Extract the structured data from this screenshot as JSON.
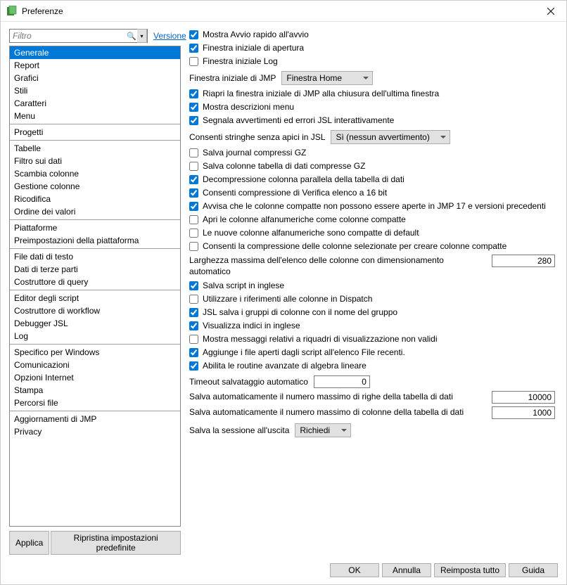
{
  "title": "Preferenze",
  "filter_placeholder": "Filtro",
  "version_link": "Versione",
  "categories": {
    "groups": [
      [
        "Generale",
        "Report",
        "Grafici",
        "Stili",
        "Caratteri",
        "Menu"
      ],
      [
        "Progetti"
      ],
      [
        "Tabelle",
        "Filtro sui dati",
        "Scambia colonne",
        "Gestione colonne",
        "Ricodifica",
        "Ordine dei valori"
      ],
      [
        "Piattaforme",
        "Preimpostazioni della piattaforma"
      ],
      [
        "File dati di testo",
        "Dati di terze parti",
        "Costruttore di query"
      ],
      [
        "Editor degli script",
        "Costruttore di workflow",
        "Debugger JSL",
        "Log"
      ],
      [
        "Specifico per Windows",
        "Comunicazioni",
        "Opzioni Internet",
        "Stampa",
        "Percorsi file"
      ],
      [
        "Aggiornamenti di JMP",
        "Privacy"
      ]
    ],
    "selected": "Generale"
  },
  "left_buttons": {
    "apply": "Applica",
    "restore": "Ripristina impostazioni predefinite"
  },
  "opts": {
    "c1": "Mostra Avvio rapido all'avvio",
    "c2": "Finestra iniziale di apertura",
    "c3": "Finestra iniziale Log",
    "lbl_initwin": "Finestra iniziale di JMP",
    "dd_initwin": "Finestra Home",
    "c4": "Riapri la finestra iniziale di JMP alla chiusura dell'ultima finestra",
    "c5": "Mostra descrizioni menu",
    "c6": "Segnala avvertimenti ed errori JSL interattivamente",
    "lbl_jslstr": "Consenti stringhe senza apici in JSL",
    "dd_jslstr": "Sì (nessun avvertimento)",
    "c7": "Salva journal compressi GZ",
    "c8": "Salva colonne tabella di dati compresse GZ",
    "c9": "Decompressione colonna parallela della tabella di dati",
    "c10": "Consenti compressione di Verifica elenco a 16 bit",
    "c11": "Avvisa che le colonne compatte non possono essere aperte in JMP 17 e versioni precedenti",
    "c12": "Apri le colonne alfanumeriche come colonne compatte",
    "c13": "Le nuove colonne alfanumeriche sono compatte di default",
    "c14": "Consenti la compressione delle colonne selezionate per creare colonne compatte",
    "lbl_maxwidth": "Larghezza massima dell'elenco delle colonne con dimensionamento automatico",
    "val_maxwidth": "280",
    "c15": "Salva script in inglese",
    "c16": "Utilizzare i riferimenti alle colonne in Dispatch",
    "c17": "JSL salva i gruppi di colonne con il nome del gruppo",
    "c18": "Visualizza indici in inglese",
    "c19": "Mostra messaggi relativi a riquadri di visualizzazione non validi",
    "c20": "Aggiunge i file aperti dagli script all'elenco File recenti.",
    "c21": "Abilita le routine avanzate di algebra lineare",
    "lbl_timeout": "Timeout salvataggio automatico",
    "val_timeout": "0",
    "lbl_maxrows": "Salva automaticamente il numero massimo di righe della tabella di dati",
    "val_maxrows": "10000",
    "lbl_maxcols": "Salva automaticamente il numero massimo di colonne della tabella di dati",
    "val_maxcols": "1000",
    "lbl_session": "Salva la sessione all'uscita",
    "dd_session": "Richiedi"
  },
  "footer": {
    "ok": "OK",
    "cancel": "Annulla",
    "resetall": "Reimposta tutto",
    "help": "Guida"
  }
}
